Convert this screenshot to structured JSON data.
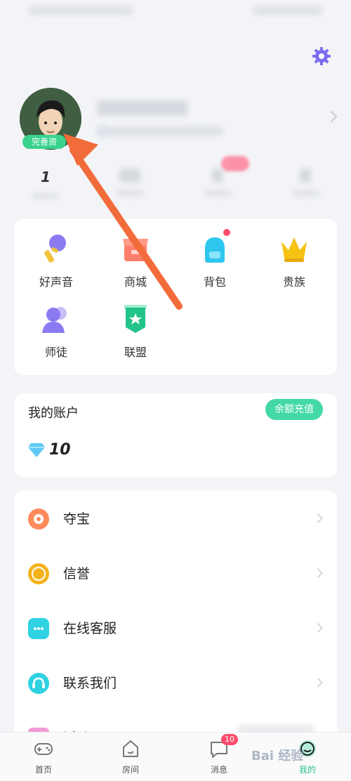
{
  "profile": {
    "complete_badge": "完善资"
  },
  "stats": {
    "first_value": "1"
  },
  "features": [
    {
      "label": "好声音",
      "icon": "microphone-icon"
    },
    {
      "label": "商城",
      "icon": "shop-icon"
    },
    {
      "label": "背包",
      "icon": "backpack-icon"
    },
    {
      "label": "贵族",
      "icon": "crown-icon"
    },
    {
      "label": "师徒",
      "icon": "mentor-icon"
    },
    {
      "label": "联盟",
      "icon": "league-flag-icon"
    }
  ],
  "account": {
    "title": "我的账户",
    "recharge": "余额充值",
    "balance": "10"
  },
  "menu": [
    {
      "label": "夺宝",
      "icon": "treasure-icon",
      "color": "#ff8a5c"
    },
    {
      "label": "信誉",
      "icon": "credit-icon",
      "color": "#f5b21c"
    },
    {
      "label": "在线客服",
      "icon": "chat-icon",
      "color": "#2fd2e2"
    },
    {
      "label": "联系我们",
      "icon": "headset-icon",
      "color": "#2fd2e2"
    },
    {
      "label": "活动",
      "icon": "activity-icon",
      "color": "#f29ad8"
    }
  ],
  "tabs": [
    {
      "label": "首页",
      "icon": "gamepad-icon"
    },
    {
      "label": "房间",
      "icon": "room-icon"
    },
    {
      "label": "消息",
      "icon": "message-icon",
      "badge": "10"
    },
    {
      "label": "我的",
      "icon": "me-icon"
    }
  ],
  "watermark": "Bai 经验",
  "colors": {
    "accent_green": "#39d38f",
    "settings_purple": "#7b6cf0",
    "arrow": "#f26b3a"
  }
}
